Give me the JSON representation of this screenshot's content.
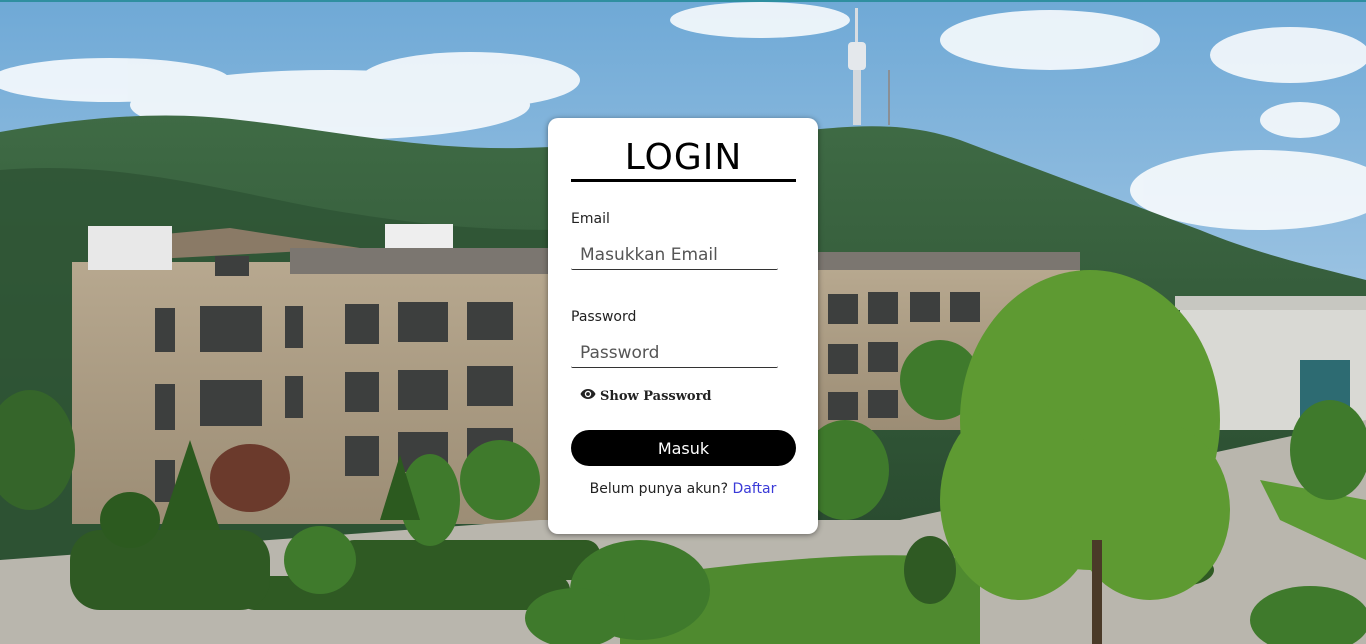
{
  "login": {
    "title": "LOGIN",
    "email_label": "Email",
    "email_placeholder": "Masukkan Email",
    "email_value": "",
    "password_label": "Password",
    "password_placeholder": "Password",
    "password_value": "",
    "show_password_label": "Show Password",
    "show_password_icon": "eye-icon",
    "submit_label": "Masuk",
    "footer_text": "Belum punya akun?",
    "signup_link": "Daftar"
  },
  "colors": {
    "accent_line": "#2f8fa0",
    "button_bg": "#000000",
    "link": "#3a3ad8"
  }
}
